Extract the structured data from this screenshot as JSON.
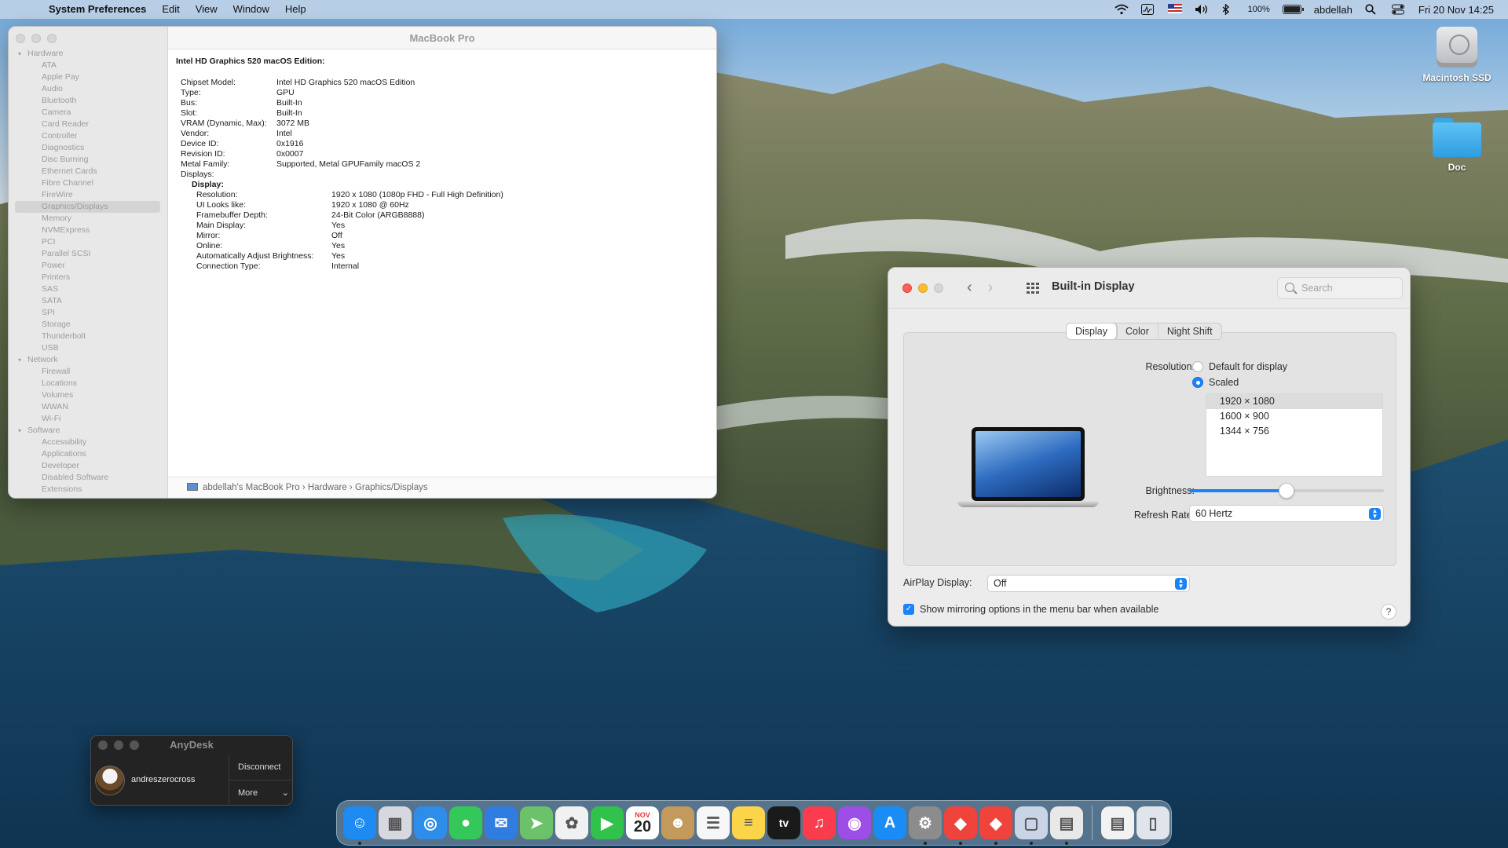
{
  "menubar": {
    "app_name": "System Preferences",
    "menus": [
      "Edit",
      "View",
      "Window",
      "Help"
    ],
    "battery": "100%",
    "user": "abdellah",
    "datetime": "Fri 20 Nov  14:25"
  },
  "desktop": {
    "icons": [
      {
        "label": "Macintosh SSD",
        "icon": "hard-drive-icon"
      },
      {
        "label": "Doc",
        "icon": "folder-icon"
      }
    ]
  },
  "sysinfo": {
    "window_title": "MacBook Pro",
    "sidebar": {
      "hardware_group": "Hardware",
      "hardware_items": [
        "ATA",
        "Apple Pay",
        "Audio",
        "Bluetooth",
        "Camera",
        "Card Reader",
        "Controller",
        "Diagnostics",
        "Disc Burning",
        "Ethernet Cards",
        "Fibre Channel",
        "FireWire",
        "Graphics/Displays",
        "Memory",
        "NVMExpress",
        "PCI",
        "Parallel SCSI",
        "Power",
        "Printers",
        "SAS",
        "SATA",
        "SPI",
        "Storage",
        "Thunderbolt",
        "USB"
      ],
      "selected_item": "Graphics/Displays",
      "network_group": "Network",
      "network_items": [
        "Firewall",
        "Locations",
        "Volumes",
        "WWAN",
        "Wi-Fi"
      ],
      "software_group": "Software",
      "software_items": [
        "Accessibility",
        "Applications",
        "Developer",
        "Disabled Software",
        "Extensions"
      ]
    },
    "heading": "Intel HD Graphics 520 macOS Edition:",
    "details": [
      {
        "k": "Chipset Model:",
        "v": "Intel HD Graphics 520 macOS Edition"
      },
      {
        "k": "Type:",
        "v": "GPU"
      },
      {
        "k": "Bus:",
        "v": "Built-In"
      },
      {
        "k": "Slot:",
        "v": "Built-In"
      },
      {
        "k": "VRAM (Dynamic, Max):",
        "v": "3072 MB"
      },
      {
        "k": "Vendor:",
        "v": "Intel"
      },
      {
        "k": "Device ID:",
        "v": "0x1916"
      },
      {
        "k": "Revision ID:",
        "v": "0x0007"
      },
      {
        "k": "Metal Family:",
        "v": "Supported, Metal GPUFamily macOS 2"
      },
      {
        "k": "Displays:",
        "v": ""
      }
    ],
    "display_sub_heading": "Display:",
    "display_details": [
      {
        "k": "Resolution:",
        "v": "1920 x 1080 (1080p FHD - Full High Definition)"
      },
      {
        "k": "UI Looks like:",
        "v": "1920 x 1080 @ 60Hz"
      },
      {
        "k": "Framebuffer Depth:",
        "v": "24-Bit Color (ARGB8888)"
      },
      {
        "k": "Main Display:",
        "v": "Yes"
      },
      {
        "k": "Mirror:",
        "v": "Off"
      },
      {
        "k": "Online:",
        "v": "Yes"
      },
      {
        "k": "Automatically Adjust Brightness:",
        "v": "Yes"
      },
      {
        "k": "Connection Type:",
        "v": "Internal"
      }
    ],
    "path": "abdellah's MacBook Pro  ›  Hardware  ›  Graphics/Displays"
  },
  "prefs": {
    "title": "Built-in Display",
    "search_placeholder": "Search",
    "tabs": [
      "Display",
      "Color",
      "Night Shift"
    ],
    "active_tab": "Display",
    "resolution_label": "Resolution:",
    "radio_default": "Default for display",
    "radio_scaled": "Scaled",
    "resolutions": [
      "1920 × 1080",
      "1600 × 900",
      "1344 × 756"
    ],
    "selected_resolution": "1920 × 1080",
    "brightness_label": "Brightness:",
    "brightness_level": 0.5,
    "refresh_label": "Refresh Rate:",
    "refresh_value": "60 Hertz",
    "airplay_label": "AirPlay Display:",
    "airplay_value": "Off",
    "mirroring_checkbox": "Show mirroring options in the menu bar when available",
    "help": "?"
  },
  "anydesk": {
    "title": "AnyDesk",
    "user": "andreszerocross",
    "disconnect": "Disconnect",
    "more": "More"
  },
  "dock": {
    "apps": [
      {
        "name": "finder-icon",
        "color": "#1e8bf2"
      },
      {
        "name": "launchpad-icon",
        "color": "#d7d7df"
      },
      {
        "name": "safari-icon",
        "color": "#2d8de8"
      },
      {
        "name": "messages-icon",
        "color": "#34c759"
      },
      {
        "name": "mail-icon",
        "color": "#2f7de1"
      },
      {
        "name": "maps-icon",
        "color": "#6cc26b"
      },
      {
        "name": "photos-icon",
        "color": "#f1f1f1"
      },
      {
        "name": "facetime-icon",
        "color": "#30c24a"
      },
      {
        "name": "calendar-icon",
        "color": "#ffffff"
      },
      {
        "name": "contacts-icon",
        "color": "#c39a5b"
      },
      {
        "name": "reminders-icon",
        "color": "#f7f7f7"
      },
      {
        "name": "notes-icon",
        "color": "#fbd44a"
      },
      {
        "name": "tv-icon",
        "color": "#1a1a1a"
      },
      {
        "name": "music-icon",
        "color": "#fa3c4e"
      },
      {
        "name": "podcasts-icon",
        "color": "#9d4ee6"
      },
      {
        "name": "app-store-icon",
        "color": "#1a8cf5"
      },
      {
        "name": "system-preferences-icon",
        "color": "#8c8c8c"
      },
      {
        "name": "anydesk-icon",
        "color": "#ef443b"
      },
      {
        "name": "anydesk-2-icon",
        "color": "#ef443b"
      },
      {
        "name": "preview-icon",
        "color": "#c9d4e6"
      },
      {
        "name": "printer-icon",
        "color": "#e8e8e8"
      }
    ],
    "calendar_month": "NOV",
    "calendar_day": "20",
    "tv_label": "tv",
    "docs": [
      {
        "name": "document-stack-icon",
        "color": "#f2f2f2"
      },
      {
        "name": "trash-icon",
        "color": "#dfe5ea"
      }
    ]
  }
}
